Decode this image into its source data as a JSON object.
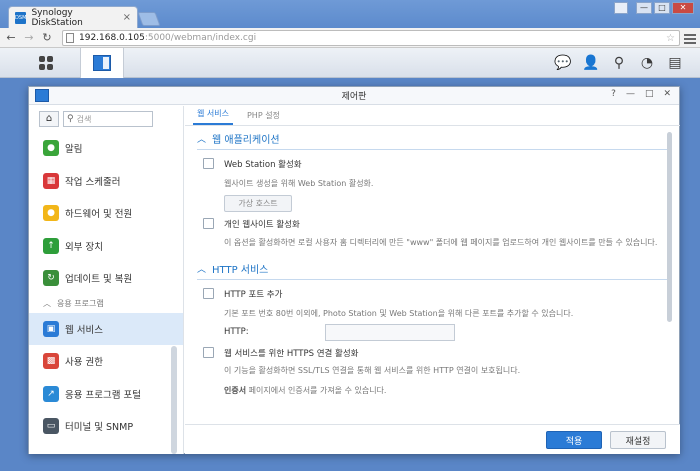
{
  "browser": {
    "tab_title": "Synology DiskStation",
    "tab_favicon": "DSM",
    "tab_close": "×",
    "url_host": "192.168.0.105",
    "url_port": ":5000",
    "url_path": "/webman/index.cgi",
    "window_min": "—",
    "window_max": "□",
    "window_close": "✕"
  },
  "taskbar": {
    "icons": [
      "chat-icon",
      "user-icon",
      "search-icon",
      "dashboard-icon",
      "widgets-icon"
    ]
  },
  "window": {
    "title": "제어판",
    "buttons": [
      "?",
      "—",
      "□",
      "✕"
    ]
  },
  "sidebar": {
    "search_placeholder": "검색",
    "items": [
      {
        "label": "알림",
        "icon": "chat-bubble-icon",
        "color": "#3aa53a"
      },
      {
        "label": "작업 스케줄러",
        "icon": "calendar-icon",
        "color": "#d9383a"
      },
      {
        "label": "하드웨어 및 전원",
        "icon": "bulb-icon",
        "color": "#f2b619"
      },
      {
        "label": "외부 장치",
        "icon": "upload-icon",
        "color": "#2e9e3a"
      },
      {
        "label": "업데이트 및 복원",
        "icon": "update-icon",
        "color": "#3a8f3a"
      }
    ],
    "section_label": "응용 프로그램",
    "app_items": [
      {
        "label": "웹 서비스",
        "icon": "web-icon",
        "color": "#2b7bd6",
        "active": true
      },
      {
        "label": "사용 권한",
        "icon": "permission-icon",
        "color": "#d9463a",
        "active": false
      },
      {
        "label": "응용 프로그램 포털",
        "icon": "portal-icon",
        "color": "#2b8ad6",
        "active": false
      },
      {
        "label": "터미널 및 SNMP",
        "icon": "terminal-icon",
        "color": "#4a5663",
        "active": false
      }
    ]
  },
  "tabs": [
    {
      "label": "웹 서비스",
      "active": true
    },
    {
      "label": "PHP 설정",
      "active": false
    }
  ],
  "web_app": {
    "heading": "웹 애플리케이션",
    "web_station_label": "Web Station 활성화",
    "web_station_desc": "웹사이트 생성을 위해 Web Station 활성화.",
    "virtual_host_button": "가상 호스트",
    "personal_site_label": "개인 웹사이트 활성화",
    "personal_site_desc": "이 옵션을 활성화하면 로컬 사용자 홈 디렉터리에 만든 \"www\" 폴더에 웹 페이지를 업로드하여 개인 웹사이트를 만들 수 있습니다."
  },
  "http_service": {
    "heading": "HTTP 서비스",
    "port_label": "HTTP 포트 추가",
    "port_desc": "기본 포트 번호 80번 이외에, Photo Station 및 Web Station을 위해 다른 포트를 추가할 수 있습니다.",
    "http_field_label": "HTTP:",
    "http_field_value": "",
    "https_label": "웹 서비스를 위한 HTTPS 연결 활성화",
    "https_desc": "이 기능을 활성화하면 SSL/TLS 연결을 통해 웹 서비스를 위한 HTTP 연결이 보호됩니다.",
    "cert_link": "인증서",
    "cert_desc": " 페이지에서 인증서를 가져올 수 있습니다."
  },
  "footer": {
    "apply": "적용",
    "reset": "재설정"
  }
}
